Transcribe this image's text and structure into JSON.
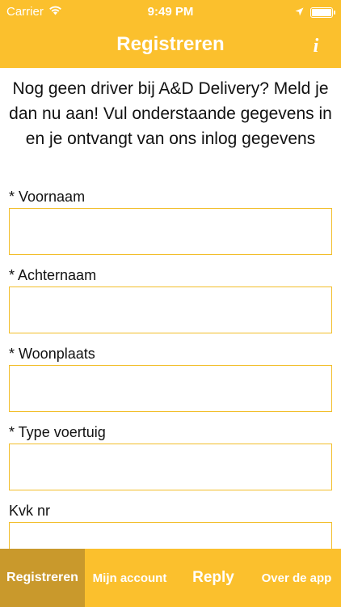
{
  "status_bar": {
    "carrier": "Carrier",
    "time": "9:49 PM",
    "icons": [
      "wifi-icon",
      "location-arrow-icon",
      "battery-icon"
    ]
  },
  "nav": {
    "title": "Registreren",
    "info_label": "i"
  },
  "intro_text": "Nog geen driver bij A&D Delivery? Meld je dan nu aan! Vul onderstaande gegevens in en je ontvangt van ons inlog gegevens",
  "form": {
    "fields": [
      {
        "label": "* Voornaam",
        "value": ""
      },
      {
        "label": "* Achternaam",
        "value": ""
      },
      {
        "label": "* Woonplaats",
        "value": ""
      },
      {
        "label": "* Type voertuig",
        "value": ""
      },
      {
        "label": "Kvk nr",
        "value": ""
      }
    ]
  },
  "tabs": [
    {
      "label": "Registreren",
      "active": true
    },
    {
      "label": "Mijn account",
      "active": false
    },
    {
      "label": "Reply",
      "active": false
    },
    {
      "label": "Over de app",
      "active": false
    }
  ],
  "colors": {
    "brand_yellow": "#FBC02D",
    "active_tab": "#C9992C",
    "field_border": "#F2BE2A"
  }
}
